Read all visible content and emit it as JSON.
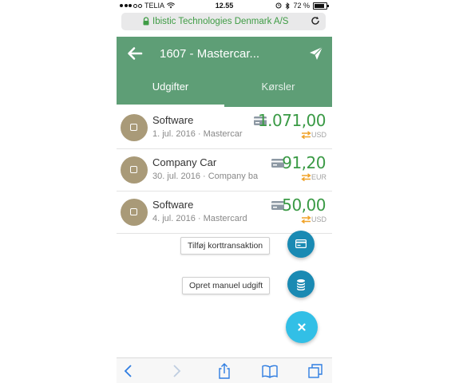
{
  "status_bar": {
    "carrier": "TELIA",
    "time": "12.55",
    "battery": "72 %",
    "battery_level": 0.72
  },
  "browser": {
    "url": "Ibistic Technologies Denmark A/S"
  },
  "header": {
    "title": "1607 - Mastercar..."
  },
  "tabs": [
    {
      "label": "Udgifter",
      "active": true
    },
    {
      "label": "Kørsler",
      "active": false
    }
  ],
  "expenses": [
    {
      "name": "Software",
      "subtitle": "1. jul. 2016 · Mastercar",
      "amount": "1.071,00",
      "currency": "USD"
    },
    {
      "name": "Company Car",
      "subtitle": "30. jul. 2016 · Company ba",
      "amount": "91,20",
      "currency": "EUR"
    },
    {
      "name": "Software",
      "subtitle": "4. jul. 2016 · Mastercard",
      "amount": "50,00",
      "currency": "USD"
    }
  ],
  "fab_menu": {
    "add_card_transaction": "Tilføj korttransaktion",
    "create_manual_expense": "Opret manuel udgift"
  },
  "colors": {
    "header": "#5e9e76",
    "amount": "#3a9a45",
    "fab_small": "#1a8ab3",
    "fab_big": "#32bfe6",
    "exchange": "#f0a32a"
  },
  "icons": [
    "back-arrow-icon",
    "send-icon",
    "card-icon",
    "exchange-icon",
    "coins-icon",
    "close-icon",
    "share-icon",
    "bookmarks-icon",
    "tabs-icon"
  ]
}
